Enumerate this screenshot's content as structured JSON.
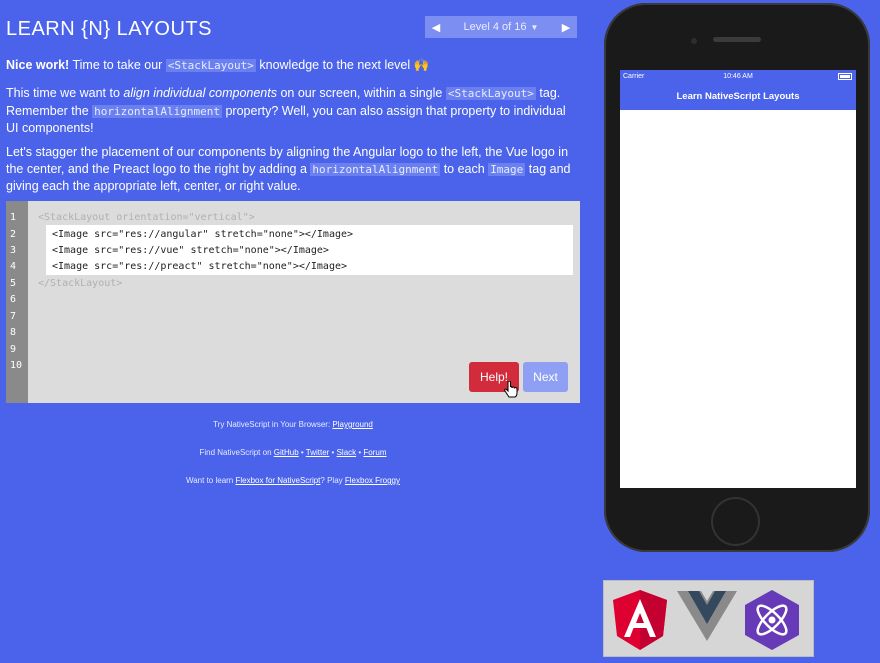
{
  "title": "LEARN {N} LAYOUTS",
  "level": {
    "prev_icon": "◀",
    "label": "Level 4 of 16",
    "caret": "▼",
    "next_icon": "▶"
  },
  "intro": {
    "lead": "Nice work!",
    "t1": " Time to take our ",
    "code1": "<StackLayout>",
    "t2": " knowledge to the next level ",
    "emoji": "🙌"
  },
  "para2": {
    "t1": "This time we want to ",
    "em": "align individual components",
    "t2": " on our screen, within a single ",
    "code1": "<StackLayout>",
    "t3": " tag. Remember the ",
    "code2": "horizontalAlignment",
    "t4": " property? Well, you can also assign that property to individual UI components!"
  },
  "para3": {
    "t1": "Let's stagger the placement of our components by aligning the Angular logo to the left, the Vue logo in the center, and the Preact logo to the right by adding a ",
    "code1": "horizontalAlignment",
    "t2": " to each ",
    "code2": "Image",
    "t3": " tag and giving each the appropriate left, center, or right value."
  },
  "editor": {
    "line_numbers": [
      "1",
      "2",
      "3",
      "4",
      "5",
      "6",
      "7",
      "8",
      "9",
      "10"
    ],
    "line1": "<StackLayout orientation=\"vertical\">",
    "input_lines": [
      "<Image src=\"res://angular\" stretch=\"none\"></Image>",
      "<Image src=\"res://vue\" stretch=\"none\"></Image>",
      "<Image src=\"res://preact\" stretch=\"none\"></Image>"
    ],
    "line5": "</StackLayout>",
    "help_label": "Help!",
    "next_label": "Next"
  },
  "footer": {
    "f1_text": "Try NativeScript in Your Browser: ",
    "f1_link": "Playground",
    "f2_text": "Find NativeScript on ",
    "f2_links": [
      "GitHub",
      "Twitter",
      "Slack",
      "Forum"
    ],
    "f2_sep": " • ",
    "f3_text1": "Want to learn ",
    "f3_link1": "Flexbox for NativeScript",
    "f3_text2": "? Play ",
    "f3_link2": "Flexbox Froggy"
  },
  "phone": {
    "carrier": "Carrier",
    "time": "10:46 AM",
    "app_title": "Learn NativeScript Layouts"
  },
  "logos": [
    "angular-logo",
    "vue-logo",
    "preact-logo"
  ],
  "colors": {
    "background": "#4a63ea",
    "help": "#d22c3c",
    "next": "#8fa0f4",
    "angular": "#dd0031",
    "vue_dark": "#35495e",
    "vue_light": "#8a8a8a",
    "preact": "#673ab8"
  }
}
